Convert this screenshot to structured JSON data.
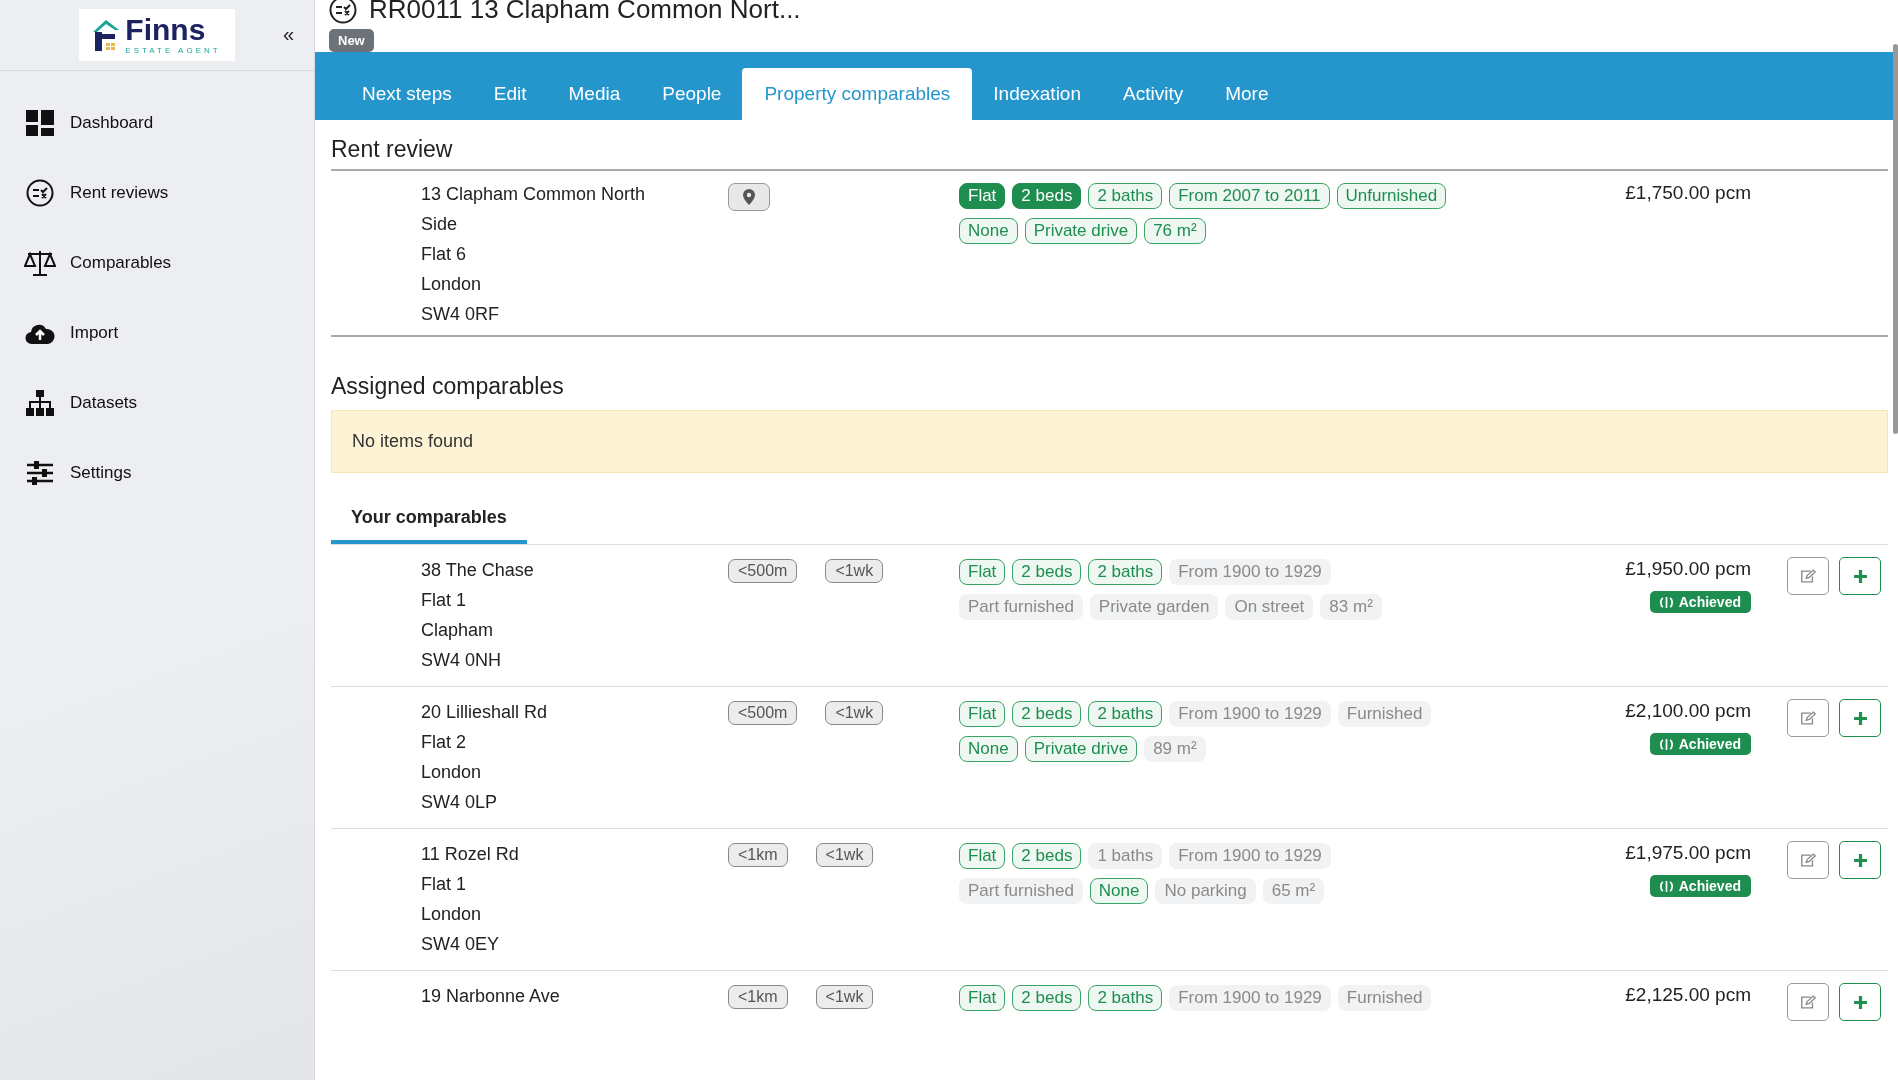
{
  "sidebar": {
    "logo": {
      "name": "Finns",
      "tagline": "ESTATE AGENT"
    },
    "collapse": "«",
    "items": [
      {
        "label": "Dashboard",
        "selected": false
      },
      {
        "label": "Rent reviews",
        "selected": false
      },
      {
        "label": "Comparables",
        "selected": false
      },
      {
        "label": "Import",
        "selected": false
      },
      {
        "label": "Datasets",
        "selected": false
      },
      {
        "label": "Settings",
        "selected": false
      }
    ]
  },
  "header": {
    "title": "RR0011 13 Clapham Common Nort...",
    "badge": "New"
  },
  "tabs": [
    {
      "label": "Next steps",
      "selected": false
    },
    {
      "label": "Edit",
      "selected": false
    },
    {
      "label": "Media",
      "selected": false
    },
    {
      "label": "People",
      "selected": false
    },
    {
      "label": "Property comparables",
      "selected": true
    },
    {
      "label": "Indexation",
      "selected": false
    },
    {
      "label": "Activity",
      "selected": false
    },
    {
      "label": "More",
      "selected": false
    }
  ],
  "rent_review": {
    "heading": "Rent review",
    "address": [
      "13 Clapham Common North",
      "Side",
      "Flat 6",
      "London",
      "SW4 0RF"
    ],
    "price": "£1,750.00 pcm",
    "tag_lines": [
      [
        {
          "text": "Flat",
          "kind": "solid"
        },
        {
          "text": "2 beds",
          "kind": "solid"
        },
        {
          "text": "2 baths",
          "kind": "outline"
        },
        {
          "text": "From 2007 to 2011",
          "kind": "outline"
        },
        {
          "text": "Unfurnished",
          "kind": "outline"
        }
      ],
      [
        {
          "text": "None",
          "kind": "outline"
        },
        {
          "text": "Private drive",
          "kind": "outline"
        },
        {
          "text": "76 m²",
          "kind": "outline"
        }
      ]
    ]
  },
  "assigned": {
    "heading": "Assigned comparables",
    "empty_message": "No items found"
  },
  "sub_tabs": [
    {
      "label": "Your comparables",
      "selected": true
    }
  ],
  "comparables": [
    {
      "address": [
        "38 The Chase",
        "Flat 1",
        "Clapham",
        "SW4 0NH"
      ],
      "distance": "<500m",
      "age": "<1wk",
      "price": "£1,950.00 pcm",
      "status": "Achieved",
      "tag_lines": [
        [
          {
            "text": "Flat",
            "kind": "outline"
          },
          {
            "text": "2 beds",
            "kind": "outline"
          },
          {
            "text": "2 baths",
            "kind": "outline"
          },
          {
            "text": "From 1900 to 1929",
            "kind": "muted"
          }
        ],
        [
          {
            "text": "Part furnished",
            "kind": "muted"
          },
          {
            "text": "Private garden",
            "kind": "muted"
          },
          {
            "text": "On street",
            "kind": "muted"
          },
          {
            "text": "83 m²",
            "kind": "muted"
          }
        ]
      ]
    },
    {
      "address": [
        "20 Lillieshall Rd",
        "Flat 2",
        "London",
        "SW4 0LP"
      ],
      "distance": "<500m",
      "age": "<1wk",
      "price": "£2,100.00 pcm",
      "status": "Achieved",
      "tag_lines": [
        [
          {
            "text": "Flat",
            "kind": "outline"
          },
          {
            "text": "2 beds",
            "kind": "outline"
          },
          {
            "text": "2 baths",
            "kind": "outline"
          },
          {
            "text": "From 1900 to 1929",
            "kind": "muted"
          },
          {
            "text": "Furnished",
            "kind": "muted"
          }
        ],
        [
          {
            "text": "None",
            "kind": "outline"
          },
          {
            "text": "Private drive",
            "kind": "outline"
          },
          {
            "text": "89 m²",
            "kind": "muted"
          }
        ]
      ]
    },
    {
      "address": [
        "11 Rozel Rd",
        "Flat 1",
        "London",
        "SW4 0EY"
      ],
      "distance": "<1km",
      "age": "<1wk",
      "price": "£1,975.00 pcm",
      "status": "Achieved",
      "tag_lines": [
        [
          {
            "text": "Flat",
            "kind": "outline"
          },
          {
            "text": "2 beds",
            "kind": "outline"
          },
          {
            "text": "1 baths",
            "kind": "muted"
          },
          {
            "text": "From 1900 to 1929",
            "kind": "muted"
          }
        ],
        [
          {
            "text": "Part furnished",
            "kind": "muted"
          },
          {
            "text": "None",
            "kind": "outline"
          },
          {
            "text": "No parking",
            "kind": "muted"
          },
          {
            "text": "65 m²",
            "kind": "muted"
          }
        ]
      ]
    },
    {
      "address": [
        "19 Narbonne Ave"
      ],
      "distance": "<1km",
      "age": "<1wk",
      "price": "£2,125.00 pcm",
      "tag_lines": [
        [
          {
            "text": "Flat",
            "kind": "outline"
          },
          {
            "text": "2 beds",
            "kind": "outline"
          },
          {
            "text": "2 baths",
            "kind": "outline"
          },
          {
            "text": "From 1900 to 1929",
            "kind": "muted"
          },
          {
            "text": "Furnished",
            "kind": "muted"
          }
        ]
      ]
    }
  ]
}
